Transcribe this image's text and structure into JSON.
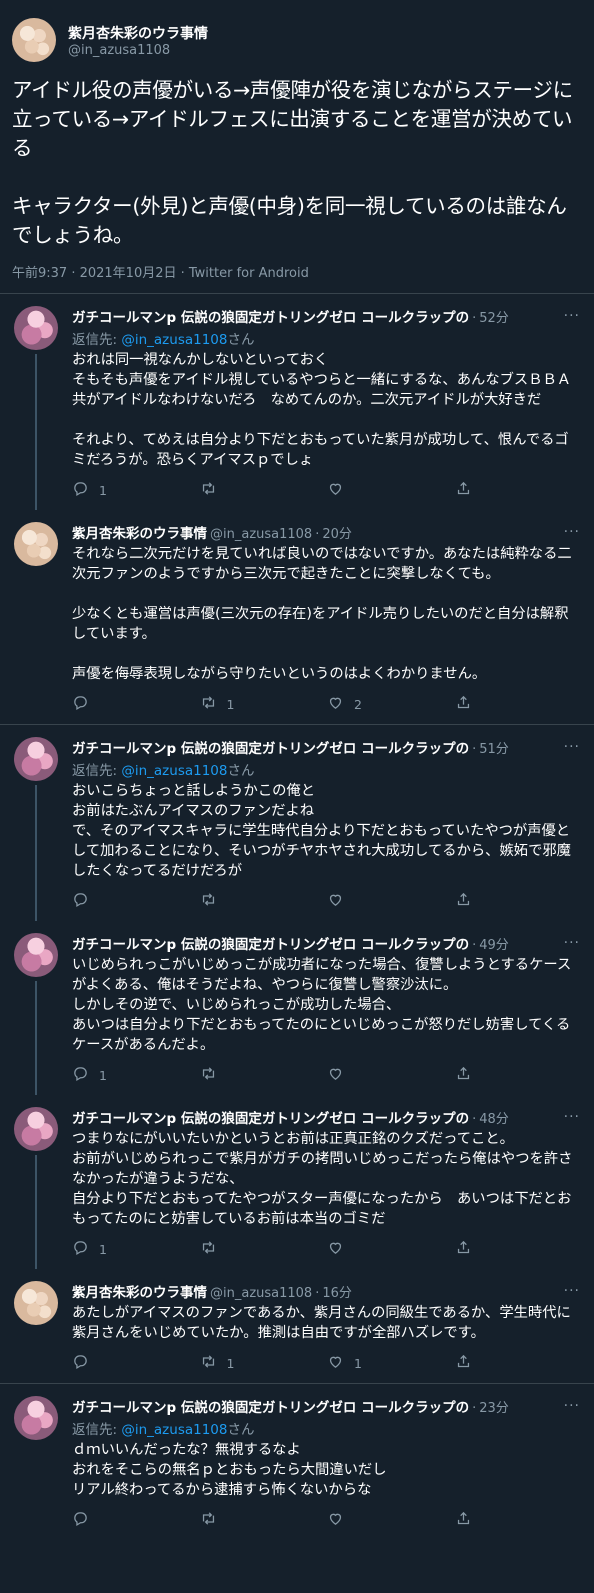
{
  "main": {
    "name": "紫月杏朱彩のウラ事情",
    "handle": "@in_azusa1108",
    "text": "アイドル役の声優がいる→声優陣が役を演じながらステージに立っている→アイドルフェスに出演することを運営が決めている\n\nキャラクター(外見)と声優(中身)を同一視しているのは誰なんでしょうね。",
    "meta": "午前9:37 · 2021年10月2日 · Twitter for Android"
  },
  "replies": [
    {
      "name": "ガチコールマンp 伝説の狼固定ガトリングゼロ コールクラップの",
      "handle": "",
      "time": "52分",
      "replying_label": "返信先: ",
      "replying_to": "@in_azusa1108",
      "replying_suffix": "さん",
      "text": "おれは同一視なんかしないといっておく\nそもそも声優をアイドル視しているやつらと一緒にするな、あんなブスＢＢＡ共がアイドルなわけないだろ　なめてんのか。二次元アイドルが大好きだ\n\nそれより、てめえは自分より下だとおもっていた紫月が成功して、恨んでるゴミだろうが。恐らくアイマスｐでしょ",
      "reply_count": "1",
      "rt_count": "",
      "like_count": ""
    },
    {
      "name": "紫月杏朱彩のウラ事情",
      "handle": "@in_azusa1108",
      "time": "20分",
      "text": "それなら二次元だけを見ていれば良いのではないですか。あなたは純粋なる二次元ファンのようですから三次元で起きたことに突撃しなくても。\n\n少なくとも運営は声優(三次元の存在)をアイドル売りしたいのだと自分は解釈しています。\n\n声優を侮辱表現しながら守りたいというのはよくわかりません。",
      "reply_count": "",
      "rt_count": "1",
      "like_count": "2"
    },
    {
      "name": "ガチコールマンp 伝説の狼固定ガトリングゼロ コールクラップの",
      "handle": "",
      "time": "51分",
      "replying_label": "返信先: ",
      "replying_to": "@in_azusa1108",
      "replying_suffix": "さん",
      "text": "おいこらちょっと話しようかこの俺と\nお前はたぶんアイマスのファンだよね\nで、そのアイマスキャラに学生時代自分より下だとおもっていたやつが声優として加わることになり、そいつがチヤホヤされ大成功してるから、嫉妬で邪魔したくなってるだけだろが",
      "reply_count": "",
      "rt_count": "",
      "like_count": ""
    },
    {
      "name": "ガチコールマンp 伝説の狼固定ガトリングゼロ コールクラップの",
      "handle": "",
      "time": "49分",
      "text": "いじめられっこがいじめっこが成功者になった場合、復讐しようとするケースがよくある、俺はそうだよね、やつらに復讐し警察沙汰に。\nしかしその逆で、いじめられっこが成功した場合、\nあいつは自分より下だとおもってたのにといじめっこが怒りだし妨害してくるケースがあるんだよ。",
      "reply_count": "1",
      "rt_count": "",
      "like_count": ""
    },
    {
      "name": "ガチコールマンp 伝説の狼固定ガトリングゼロ コールクラップの",
      "handle": "",
      "time": "48分",
      "text": "つまりなにがいいたいかというとお前は正真正銘のクズだってこと。\nお前がいじめられっこで紫月がガチの拷問いじめっこだったら俺はやつを許さなかったが違うようだな、\n自分より下だとおもってたやつがスター声優になったから　あいつは下だとおもってたのにと妨害しているお前は本当のゴミだ",
      "reply_count": "1",
      "rt_count": "",
      "like_count": ""
    },
    {
      "name": "紫月杏朱彩のウラ事情",
      "handle": "@in_azusa1108",
      "time": "16分",
      "text": "あたしがアイマスのファンであるか、紫月さんの同級生であるか、学生時代に紫月さんをいじめていたか。推測は自由ですが全部ハズレです。",
      "reply_count": "",
      "rt_count": "1",
      "like_count": "1"
    },
    {
      "name": "ガチコールマンp 伝説の狼固定ガトリングゼロ コールクラップの",
      "handle": "",
      "time": "23分",
      "replying_label": "返信先: ",
      "replying_to": "@in_azusa1108",
      "replying_suffix": "さん",
      "text": "ｄｍいいんだったな？無視するなよ\nおれをそこらの無名ｐとおもったら大間違いだし\nリアル終わってるから逮捕すら怖くないからな",
      "reply_count": "",
      "rt_count": "",
      "like_count": ""
    }
  ],
  "icons": [
    "reply-icon",
    "retweet-icon",
    "like-icon",
    "share-icon",
    "more-icon"
  ]
}
